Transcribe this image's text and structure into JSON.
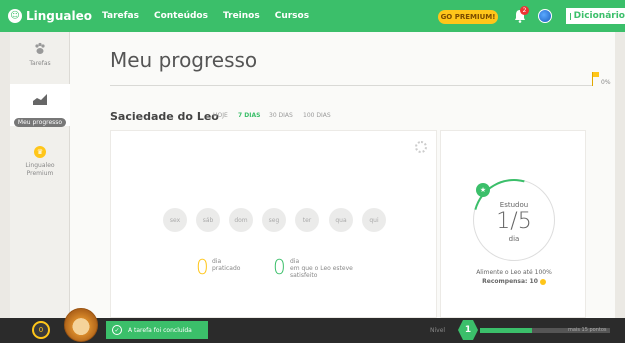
{
  "nav": {
    "brand": "Lingualeo",
    "items": [
      {
        "label": "Tarefas"
      },
      {
        "label": "Conteúdos"
      },
      {
        "label": "Treinos"
      },
      {
        "label": "Cursos"
      }
    ],
    "premium_button": "GO PREMIUM!",
    "notifications_count": "2",
    "dictionary_label": "Dicionário",
    "brand_color": "#3bbf6a",
    "accent_color": "#ffc61a"
  },
  "sidebar": {
    "items": [
      {
        "label": "Tarefas",
        "icon": "paw-icon"
      },
      {
        "label": "Meu progresso",
        "icon": "chart-icon",
        "active": true
      },
      {
        "label": "Lingualeo Premium",
        "icon": "crown-icon"
      }
    ]
  },
  "main": {
    "title": "Meu progresso",
    "progress_percent": "0%",
    "progress_value": 0,
    "section_title": "Saciedade do Leo",
    "periods": [
      {
        "label": "HOJE"
      },
      {
        "label": "7 DIAS",
        "active": true
      },
      {
        "label": "30 DIAS"
      },
      {
        "label": "100 DIAS"
      }
    ],
    "days": [
      "sex",
      "sáb",
      "dom",
      "seg",
      "ter",
      "qua",
      "qui"
    ],
    "stats": [
      {
        "value": "0",
        "text_1": "dia",
        "text_2": "praticado"
      },
      {
        "value": "0",
        "text_1": "dia",
        "text_2": "em que o Leo esteve",
        "text_3": "satisfeito"
      }
    ],
    "study": {
      "label": "Estudou",
      "value": "1/5",
      "unit": "dia",
      "feed_text": "Alimente o Leo até 100%",
      "reward_label": "Recompensa: 10"
    }
  },
  "bottom": {
    "coins": "0",
    "toast": "A tarefa foi concluída",
    "level_label": "Nível",
    "level": "1",
    "level_progress": 0.4,
    "level_hint": "mais 15 pontos"
  }
}
